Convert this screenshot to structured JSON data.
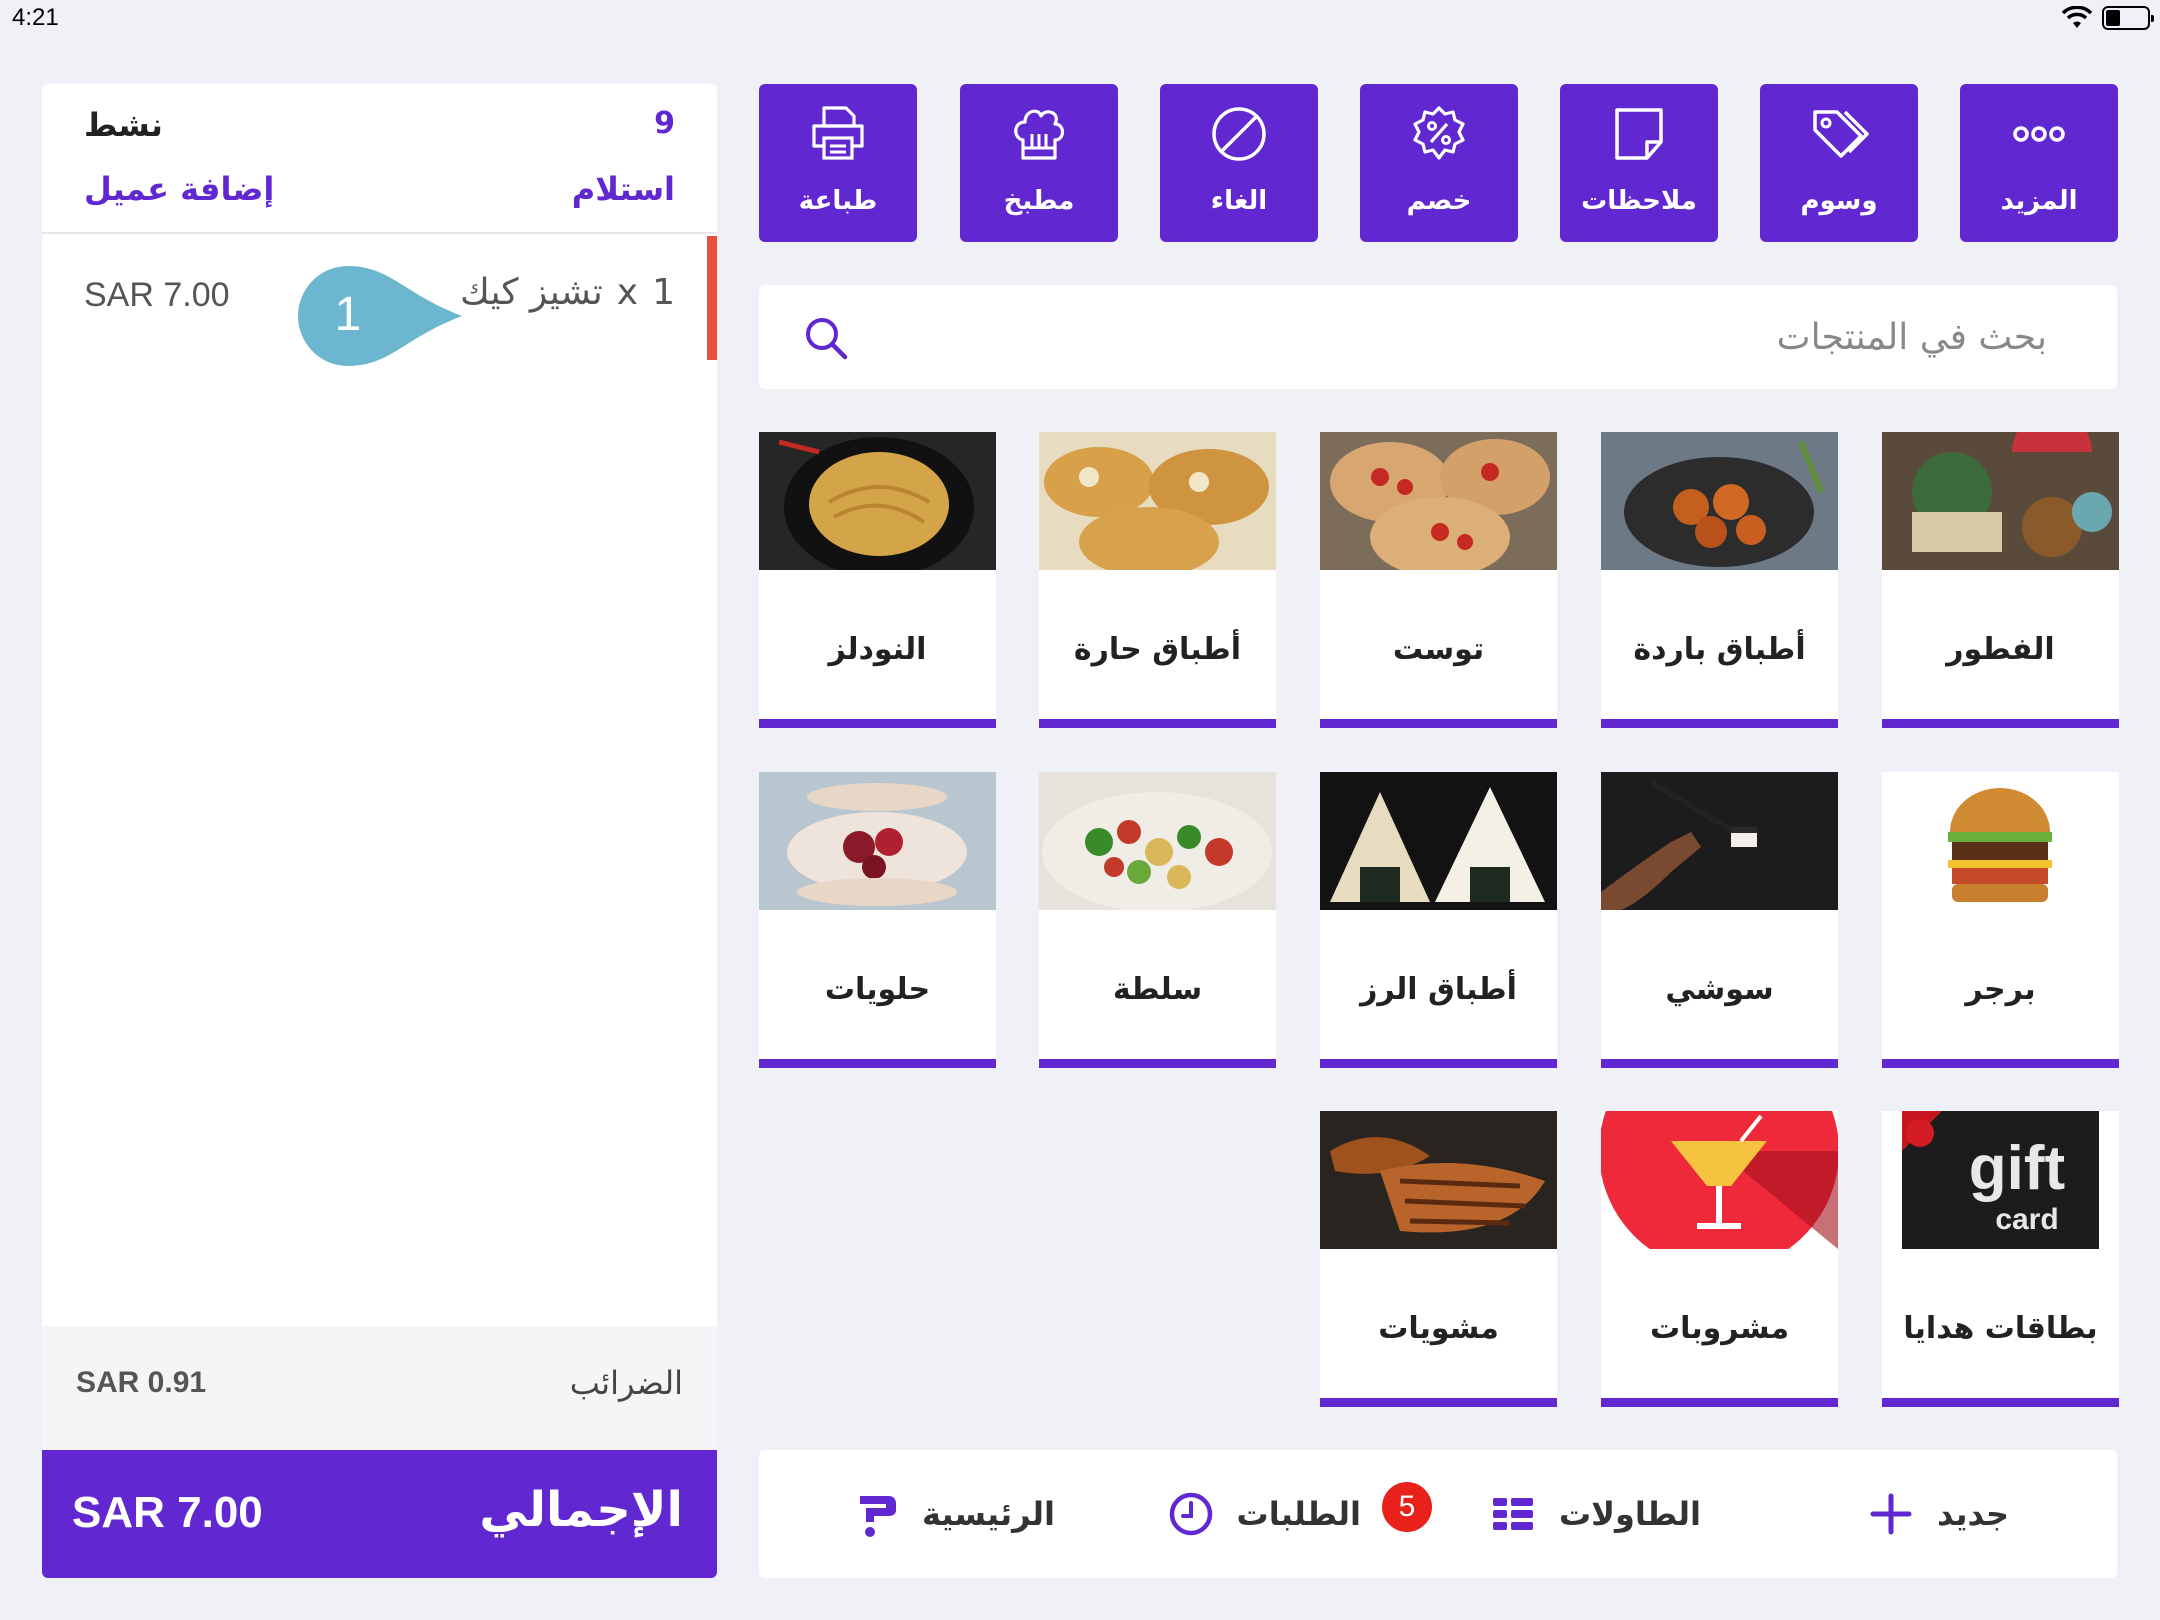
{
  "status_bar": {
    "time": "4:21"
  },
  "order": {
    "status": "نشط",
    "number": "9",
    "add_customer": "إضافة عميل",
    "type": "استلام",
    "items": [
      {
        "qty": "1",
        "times": "x",
        "name": "تشيز كيك",
        "price": "SAR 7.00"
      }
    ],
    "callout_number": "1",
    "tax_label": "الضرائب",
    "tax_value": "SAR 0.91",
    "total_label": "الإجمالي",
    "total_value": "SAR 7.00"
  },
  "actions": [
    {
      "label": "المزيد",
      "icon": "more-icon"
    },
    {
      "label": "وسوم",
      "icon": "tags-icon"
    },
    {
      "label": "ملاحظات",
      "icon": "note-icon"
    },
    {
      "label": "خصم",
      "icon": "discount-icon"
    },
    {
      "label": "الغاء",
      "icon": "cancel-icon"
    },
    {
      "label": "مطبخ",
      "icon": "chef-hat-icon"
    },
    {
      "label": "طباعة",
      "icon": "printer-icon"
    }
  ],
  "search": {
    "placeholder": "بحث في المنتجات"
  },
  "categories": [
    {
      "name": "الفطور"
    },
    {
      "name": "أطباق باردة"
    },
    {
      "name": "توست"
    },
    {
      "name": "أطباق حارة"
    },
    {
      "name": "النودلز"
    },
    {
      "name": "برجر"
    },
    {
      "name": "سوشي"
    },
    {
      "name": "أطباق الرز"
    },
    {
      "name": "سلطة"
    },
    {
      "name": "حلويات"
    },
    {
      "name": "بطاقات هدايا",
      "image_text_1": "gift",
      "image_text_2": "card"
    },
    {
      "name": "مشروبات"
    },
    {
      "name": "مشويات"
    }
  ],
  "bottom_nav": {
    "new": "جديد",
    "tables": "الطاولات",
    "orders": "الطلبات",
    "orders_badge": "5",
    "home": "الرئيسية"
  },
  "colors": {
    "primary": "#6128d1",
    "accent": "#e8503c",
    "badge": "#e8211a"
  }
}
